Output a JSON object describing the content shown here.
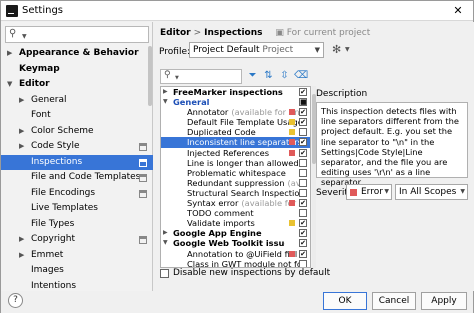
{
  "window": {
    "title": "Settings",
    "close_glyph": "✕"
  },
  "left": {
    "search_placeholder": "",
    "tree": [
      {
        "label": "Appearance & Behavior",
        "level": 0,
        "arrow": "▶",
        "bold": true
      },
      {
        "label": "Keymap",
        "level": 0,
        "arrow": "",
        "bold": true
      },
      {
        "label": "Editor",
        "level": 0,
        "arrow": "▼",
        "bold": true
      },
      {
        "label": "General",
        "level": 1,
        "arrow": "▶"
      },
      {
        "label": "Font",
        "level": 1,
        "arrow": ""
      },
      {
        "label": "Color Scheme",
        "level": 1,
        "arrow": "▶"
      },
      {
        "label": "Code Style",
        "level": 1,
        "arrow": "▶",
        "project": true
      },
      {
        "label": "Inspections",
        "level": 1,
        "arrow": "",
        "project": true,
        "selected": true
      },
      {
        "label": "File and Code Templates",
        "level": 1,
        "arrow": "",
        "project": true
      },
      {
        "label": "File Encodings",
        "level": 1,
        "arrow": "",
        "project": true
      },
      {
        "label": "Live Templates",
        "level": 1,
        "arrow": ""
      },
      {
        "label": "File Types",
        "level": 1,
        "arrow": ""
      },
      {
        "label": "Copyright",
        "level": 1,
        "arrow": "▶",
        "project": true
      },
      {
        "label": "Emmet",
        "level": 1,
        "arrow": "▶"
      },
      {
        "label": "Images",
        "level": 1,
        "arrow": ""
      },
      {
        "label": "Intentions",
        "level": 1,
        "arrow": ""
      }
    ]
  },
  "right": {
    "breadcrumb": {
      "editor": "Editor",
      "sep": ">",
      "page": "Inspections",
      "project_note": "For current project"
    },
    "profile": {
      "label": "Profile:",
      "value": "Project Default",
      "scope": "Project"
    },
    "inspections": [
      {
        "text": "FreeMarker inspections",
        "type": "group",
        "arrow": "▶",
        "check": "✔"
      },
      {
        "text": "General",
        "type": "group-blue",
        "arrow": "▼",
        "check": "■"
      },
      {
        "text": "Annotator",
        "muted": "(available for An",
        "sev": "#e05a5a",
        "check": "✔"
      },
      {
        "text": "Default File Template Usage",
        "sev": "#e9c232",
        "check": "✔"
      },
      {
        "text": "Duplicated Code",
        "sev": "#e9c232",
        "check": ""
      },
      {
        "text": "Inconsistent line separators",
        "sev": "#e05a5a",
        "check": "✔",
        "selected": true
      },
      {
        "text": "Injected References",
        "sev": "#e05a5a",
        "check": "✔"
      },
      {
        "text": "Line is longer than allowed b",
        "sev": "",
        "check": ""
      },
      {
        "text": "Problematic whitespace",
        "sev": "",
        "check": ""
      },
      {
        "text": "Redundant suppression",
        "muted": "(available",
        "sev": "",
        "check": ""
      },
      {
        "text": "Structural Search Inspection",
        "sev": "",
        "check": ""
      },
      {
        "text": "Syntax error",
        "muted": "(available for Ar",
        "sev": "#e05a5a",
        "check": "✔"
      },
      {
        "text": "TODO comment",
        "sev": "",
        "check": ""
      },
      {
        "text": "Validate imports",
        "sev": "#e9c232",
        "check": "✔"
      },
      {
        "text": "Google App Engine",
        "type": "group",
        "arrow": "▶",
        "check": "✔"
      },
      {
        "text": "Google Web Toolkit issues",
        "type": "group",
        "arrow": "▼",
        "check": "✔"
      },
      {
        "text": "Annotation to @UiField fiel",
        "sev": "#e05a5a",
        "check": "✔"
      },
      {
        "text": "Class in GWT module not fo",
        "sev": "",
        "check": ""
      }
    ],
    "description": {
      "label": "Description",
      "text": "This inspection detects files with line separators different from the project default. E.g. you set the line separator to \"\\n\" in the Settings|Code Style|Line separator, and the file you are editing uses '\\r\\n' as a line separator."
    },
    "severity": {
      "label": "Severity:",
      "value": "Error",
      "color": "#e05a5a",
      "scope": "In All Scopes"
    },
    "disable_new": "Disable new inspections by default"
  },
  "buttons": {
    "help": "?",
    "ok": "OK",
    "cancel": "Cancel",
    "apply": "Apply"
  }
}
